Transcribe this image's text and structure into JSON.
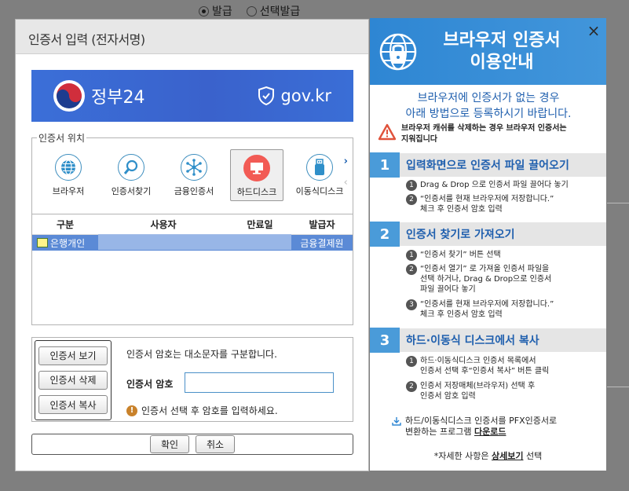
{
  "background": {
    "radio_issue": "발급",
    "radio_select_issue": "선택발급"
  },
  "dialog": {
    "title": "인증서 입력 (전자서명)",
    "banner": {
      "brand": "정부24",
      "domain": "gov.kr"
    },
    "location": {
      "legend": "인증서 위치",
      "items": [
        {
          "label": "브라우저",
          "icon": "globe-icon"
        },
        {
          "label": "인증서찾기",
          "icon": "search-icon"
        },
        {
          "label": "금융인증서",
          "icon": "network-icon"
        },
        {
          "label": "하드디스크",
          "icon": "monitor-icon"
        },
        {
          "label": "이동식디스크",
          "icon": "usb-icon"
        }
      ]
    },
    "table": {
      "headers": [
        "구분",
        "사용자",
        "만료일",
        "발급자"
      ],
      "rows": [
        {
          "type": "은행개인",
          "user": "",
          "expiry": "",
          "issuer": "금융결제원"
        }
      ]
    },
    "buttons": {
      "view": "인증서 보기",
      "delete": "인증서 삭제",
      "copy": "인증서 복사"
    },
    "password": {
      "note": "인증서 암호는 대소문자를 구분합니다.",
      "label": "인증서 암호",
      "value": "",
      "warning": "인증서 선택 후 암호를 입력하세요."
    },
    "confirm": "확인",
    "cancel": "취소"
  },
  "info": {
    "title_line1": "브라우저 인증서",
    "title_line2": "이용안내",
    "close": "×",
    "subtitle_line1": "브라우저에 인증서가 없는 경우",
    "subtitle_line2": "아래 방법으로 등록하시기 바랍니다.",
    "caution_line1": "브라우저 캐쉬를 삭제하는 경우 브라우저 인증서는",
    "caution_line2": "지워집니다",
    "sections": [
      {
        "num": "1",
        "title": "입력화면으로 인증서 파일 끌어오기",
        "steps": [
          {
            "num": "1",
            "line1": "Drag & Drop 으로 인증서 파일 끌어다 놓기",
            "line2": "",
            "line3": ""
          },
          {
            "num": "2",
            "line1": "“인증서를 현재 브라우저에 저장합니다.”",
            "line2": "체크 후 인증서 암호 입력",
            "line3": ""
          }
        ]
      },
      {
        "num": "2",
        "title": "인증서 찾기로 가져오기",
        "steps": [
          {
            "num": "1",
            "line1": "“인증서 찾기” 버튼 선택",
            "line2": "",
            "line3": ""
          },
          {
            "num": "2",
            "line1": "“인증서 열기” 로 가져올 인증서 파일을",
            "line2": "선택 하거나, Drag & Drop으로 인증서",
            "line3": "파일 끌어다 놓기"
          },
          {
            "num": "3",
            "line1": "“인증서를 현재 브라우저에 저장합니다.”",
            "line2": "체크 후 인증서 암호 입력",
            "line3": ""
          }
        ]
      },
      {
        "num": "3",
        "title": "하드·이동식 디스크에서 복사",
        "steps": [
          {
            "num": "1",
            "line1": "하드·이동식디스크 인증서 목록에서",
            "line2": "인증서 선택 후“인증서 복사” 버튼 클릭",
            "line3": ""
          },
          {
            "num": "2",
            "line1": "인증서 저장매체(브라우저) 선택 후",
            "line2": "인증서 암호 입력",
            "line3": ""
          }
        ]
      }
    ],
    "download_line1": "하드/이동식디스크 인증서를 PFX인증서로",
    "download_line2_prefix": "변환하는 프로그램 ",
    "download_link": "다운로드",
    "detail_prefix": "*자세한 사항은 ",
    "detail_link": "상세보기",
    "detail_suffix": " 선택",
    "colors": {
      "accent": "#4a9bd9",
      "title_blue": "#1f5fae",
      "selected_row": "#5b8ad6"
    }
  }
}
